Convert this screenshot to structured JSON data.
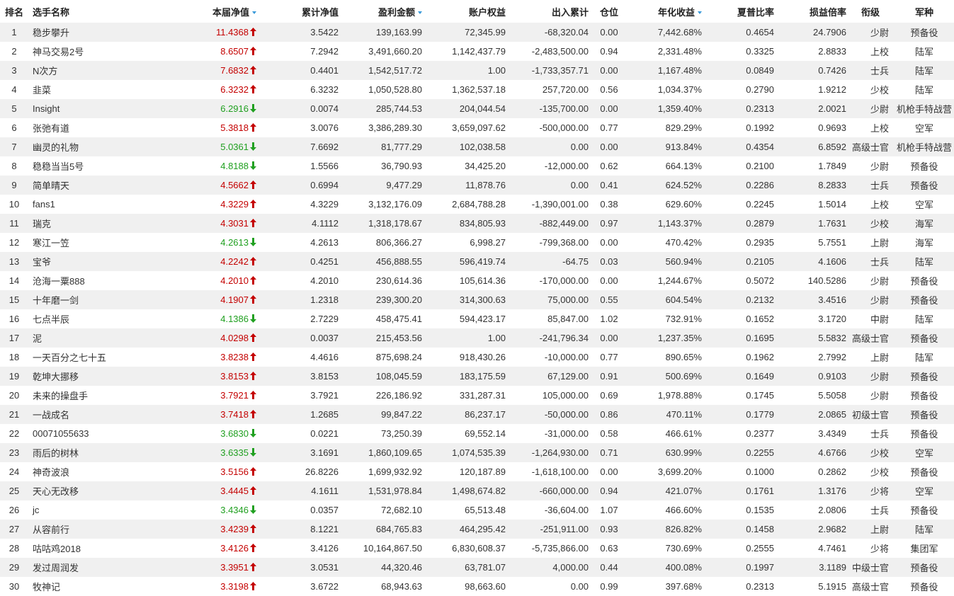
{
  "columns": {
    "rank": "排名",
    "name": "选手名称",
    "nav": "本届净值",
    "cum_nav": "累计净值",
    "profit": "盈利金额",
    "equity": "账户权益",
    "flow": "出入累计",
    "position": "仓位",
    "annual": "年化收益",
    "sharpe": "夏普比率",
    "pl_ratio": "损益倍率",
    "title": "衔级",
    "branch": "军种"
  },
  "sorted_columns": [
    "nav",
    "profit",
    "annual"
  ],
  "colors": {
    "up": "#c40000",
    "down": "#20a020",
    "stripe": "#f0f0f0",
    "sort_indicator": "#3a9ad9"
  },
  "rows": [
    {
      "rank": "1",
      "name": "稳步攀升",
      "nav": "11.4368",
      "trend": "up",
      "cum_nav": "3.5422",
      "profit": "139,163.99",
      "equity": "72,345.99",
      "flow": "-68,320.04",
      "position": "0.00",
      "annual": "7,442.68%",
      "sharpe": "0.4654",
      "pl_ratio": "24.7906",
      "title": "少尉",
      "branch": "预备役"
    },
    {
      "rank": "2",
      "name": "神马交易2号",
      "nav": "8.6507",
      "trend": "up",
      "cum_nav": "7.2942",
      "profit": "3,491,660.20",
      "equity": "1,142,437.79",
      "flow": "-2,483,500.00",
      "position": "0.94",
      "annual": "2,331.48%",
      "sharpe": "0.3325",
      "pl_ratio": "2.8833",
      "title": "上校",
      "branch": "陆军"
    },
    {
      "rank": "3",
      "name": "N次方",
      "nav": "7.6832",
      "trend": "up",
      "cum_nav": "0.4401",
      "profit": "1,542,517.72",
      "equity": "1.00",
      "flow": "-1,733,357.71",
      "position": "0.00",
      "annual": "1,167.48%",
      "sharpe": "0.0849",
      "pl_ratio": "0.7426",
      "title": "士兵",
      "branch": "陆军"
    },
    {
      "rank": "4",
      "name": "韭菜",
      "nav": "6.3232",
      "trend": "up",
      "cum_nav": "6.3232",
      "profit": "1,050,528.80",
      "equity": "1,362,537.18",
      "flow": "257,720.00",
      "position": "0.56",
      "annual": "1,034.37%",
      "sharpe": "0.2790",
      "pl_ratio": "1.9212",
      "title": "少校",
      "branch": "陆军"
    },
    {
      "rank": "5",
      "name": "Insight",
      "nav": "6.2916",
      "trend": "down",
      "cum_nav": "0.0074",
      "profit": "285,744.53",
      "equity": "204,044.54",
      "flow": "-135,700.00",
      "position": "0.00",
      "annual": "1,359.40%",
      "sharpe": "0.2313",
      "pl_ratio": "2.0021",
      "title": "少尉",
      "branch": "机枪手特战营"
    },
    {
      "rank": "6",
      "name": "张弛有道",
      "nav": "5.3818",
      "trend": "up",
      "cum_nav": "3.0076",
      "profit": "3,386,289.30",
      "equity": "3,659,097.62",
      "flow": "-500,000.00",
      "position": "0.77",
      "annual": "829.29%",
      "sharpe": "0.1992",
      "pl_ratio": "0.9693",
      "title": "上校",
      "branch": "空军"
    },
    {
      "rank": "7",
      "name": "幽灵的礼物",
      "nav": "5.0361",
      "trend": "down",
      "cum_nav": "7.6692",
      "profit": "81,777.29",
      "equity": "102,038.58",
      "flow": "0.00",
      "position": "0.00",
      "annual": "913.84%",
      "sharpe": "0.4354",
      "pl_ratio": "6.8592",
      "title": "高级士官",
      "branch": "机枪手特战营"
    },
    {
      "rank": "8",
      "name": "稳稳当当5号",
      "nav": "4.8188",
      "trend": "down",
      "cum_nav": "1.5566",
      "profit": "36,790.93",
      "equity": "34,425.20",
      "flow": "-12,000.00",
      "position": "0.62",
      "annual": "664.13%",
      "sharpe": "0.2100",
      "pl_ratio": "1.7849",
      "title": "少尉",
      "branch": "预备役"
    },
    {
      "rank": "9",
      "name": "简单晴天",
      "nav": "4.5662",
      "trend": "up",
      "cum_nav": "0.6994",
      "profit": "9,477.29",
      "equity": "11,878.76",
      "flow": "0.00",
      "position": "0.41",
      "annual": "624.52%",
      "sharpe": "0.2286",
      "pl_ratio": "8.2833",
      "title": "士兵",
      "branch": "预备役"
    },
    {
      "rank": "10",
      "name": "fans1",
      "nav": "4.3229",
      "trend": "up",
      "cum_nav": "4.3229",
      "profit": "3,132,176.09",
      "equity": "2,684,788.28",
      "flow": "-1,390,001.00",
      "position": "0.38",
      "annual": "629.60%",
      "sharpe": "0.2245",
      "pl_ratio": "1.5014",
      "title": "上校",
      "branch": "空军"
    },
    {
      "rank": "11",
      "name": "瑞克",
      "nav": "4.3031",
      "trend": "up",
      "cum_nav": "4.1112",
      "profit": "1,318,178.67",
      "equity": "834,805.93",
      "flow": "-882,449.00",
      "position": "0.97",
      "annual": "1,143.37%",
      "sharpe": "0.2879",
      "pl_ratio": "1.7631",
      "title": "少校",
      "branch": "海军"
    },
    {
      "rank": "12",
      "name": "寒江一笠",
      "nav": "4.2613",
      "trend": "down",
      "cum_nav": "4.2613",
      "profit": "806,366.27",
      "equity": "6,998.27",
      "flow": "-799,368.00",
      "position": "0.00",
      "annual": "470.42%",
      "sharpe": "0.2935",
      "pl_ratio": "5.7551",
      "title": "上尉",
      "branch": "海军"
    },
    {
      "rank": "13",
      "name": "宝爷",
      "nav": "4.2242",
      "trend": "up",
      "cum_nav": "0.4251",
      "profit": "456,888.55",
      "equity": "596,419.74",
      "flow": "-64.75",
      "position": "0.03",
      "annual": "560.94%",
      "sharpe": "0.2105",
      "pl_ratio": "4.1606",
      "title": "士兵",
      "branch": "陆军"
    },
    {
      "rank": "14",
      "name": "沧海一粟888",
      "nav": "4.2010",
      "trend": "up",
      "cum_nav": "4.2010",
      "profit": "230,614.36",
      "equity": "105,614.36",
      "flow": "-170,000.00",
      "position": "0.00",
      "annual": "1,244.67%",
      "sharpe": "0.5072",
      "pl_ratio": "140.5286",
      "title": "少尉",
      "branch": "预备役"
    },
    {
      "rank": "15",
      "name": "十年磨一剑",
      "nav": "4.1907",
      "trend": "up",
      "cum_nav": "1.2318",
      "profit": "239,300.20",
      "equity": "314,300.63",
      "flow": "75,000.00",
      "position": "0.55",
      "annual": "604.54%",
      "sharpe": "0.2132",
      "pl_ratio": "3.4516",
      "title": "少尉",
      "branch": "预备役"
    },
    {
      "rank": "16",
      "name": "七点半辰",
      "nav": "4.1386",
      "trend": "down",
      "cum_nav": "2.7229",
      "profit": "458,475.41",
      "equity": "594,423.17",
      "flow": "85,847.00",
      "position": "1.02",
      "annual": "732.91%",
      "sharpe": "0.1652",
      "pl_ratio": "3.1720",
      "title": "中尉",
      "branch": "陆军"
    },
    {
      "rank": "17",
      "name": "泥",
      "nav": "4.0298",
      "trend": "up",
      "cum_nav": "0.0037",
      "profit": "215,453.56",
      "equity": "1.00",
      "flow": "-241,796.34",
      "position": "0.00",
      "annual": "1,237.35%",
      "sharpe": "0.1695",
      "pl_ratio": "5.5832",
      "title": "高级士官",
      "branch": "预备役"
    },
    {
      "rank": "18",
      "name": "一天百分之七十五",
      "nav": "3.8238",
      "trend": "up",
      "cum_nav": "4.4616",
      "profit": "875,698.24",
      "equity": "918,430.26",
      "flow": "-10,000.00",
      "position": "0.77",
      "annual": "890.65%",
      "sharpe": "0.1962",
      "pl_ratio": "2.7992",
      "title": "上尉",
      "branch": "陆军"
    },
    {
      "rank": "19",
      "name": "乾坤大挪移",
      "nav": "3.8153",
      "trend": "up",
      "cum_nav": "3.8153",
      "profit": "108,045.59",
      "equity": "183,175.59",
      "flow": "67,129.00",
      "position": "0.91",
      "annual": "500.69%",
      "sharpe": "0.1649",
      "pl_ratio": "0.9103",
      "title": "少尉",
      "branch": "预备役"
    },
    {
      "rank": "20",
      "name": "未来的操盘手",
      "nav": "3.7921",
      "trend": "up",
      "cum_nav": "3.7921",
      "profit": "226,186.92",
      "equity": "331,287.31",
      "flow": "105,000.00",
      "position": "0.69",
      "annual": "1,978.88%",
      "sharpe": "0.1745",
      "pl_ratio": "5.5058",
      "title": "少尉",
      "branch": "预备役"
    },
    {
      "rank": "21",
      "name": "一战成名",
      "nav": "3.7418",
      "trend": "up",
      "cum_nav": "1.2685",
      "profit": "99,847.22",
      "equity": "86,237.17",
      "flow": "-50,000.00",
      "position": "0.86",
      "annual": "470.11%",
      "sharpe": "0.1779",
      "pl_ratio": "2.0865",
      "title": "初级士官",
      "branch": "预备役"
    },
    {
      "rank": "22",
      "name": "00071055633",
      "nav": "3.6830",
      "trend": "down",
      "cum_nav": "0.0221",
      "profit": "73,250.39",
      "equity": "69,552.14",
      "flow": "-31,000.00",
      "position": "0.58",
      "annual": "466.61%",
      "sharpe": "0.2377",
      "pl_ratio": "3.4349",
      "title": "士兵",
      "branch": "预备役"
    },
    {
      "rank": "23",
      "name": "雨后的树林",
      "nav": "3.6335",
      "trend": "down",
      "cum_nav": "3.1691",
      "profit": "1,860,109.65",
      "equity": "1,074,535.39",
      "flow": "-1,264,930.00",
      "position": "0.71",
      "annual": "630.99%",
      "sharpe": "0.2255",
      "pl_ratio": "4.6766",
      "title": "少校",
      "branch": "空军"
    },
    {
      "rank": "24",
      "name": "神奇波浪",
      "nav": "3.5156",
      "trend": "up",
      "cum_nav": "26.8226",
      "profit": "1,699,932.92",
      "equity": "120,187.89",
      "flow": "-1,618,100.00",
      "position": "0.00",
      "annual": "3,699.20%",
      "sharpe": "0.1000",
      "pl_ratio": "0.2862",
      "title": "少校",
      "branch": "预备役"
    },
    {
      "rank": "25",
      "name": "天心无改移",
      "nav": "3.4445",
      "trend": "up",
      "cum_nav": "4.1611",
      "profit": "1,531,978.84",
      "equity": "1,498,674.82",
      "flow": "-660,000.00",
      "position": "0.94",
      "annual": "421.07%",
      "sharpe": "0.1761",
      "pl_ratio": "1.3176",
      "title": "少将",
      "branch": "空军"
    },
    {
      "rank": "26",
      "name": "jc",
      "nav": "3.4346",
      "trend": "down",
      "cum_nav": "0.0357",
      "profit": "72,682.10",
      "equity": "65,513.48",
      "flow": "-36,604.00",
      "position": "1.07",
      "annual": "466.60%",
      "sharpe": "0.1535",
      "pl_ratio": "2.0806",
      "title": "士兵",
      "branch": "预备役"
    },
    {
      "rank": "27",
      "name": "从容前行",
      "nav": "3.4239",
      "trend": "up",
      "cum_nav": "8.1221",
      "profit": "684,765.83",
      "equity": "464,295.42",
      "flow": "-251,911.00",
      "position": "0.93",
      "annual": "826.82%",
      "sharpe": "0.1458",
      "pl_ratio": "2.9682",
      "title": "上尉",
      "branch": "陆军"
    },
    {
      "rank": "28",
      "name": "咕咕鸡2018",
      "nav": "3.4126",
      "trend": "up",
      "cum_nav": "3.4126",
      "profit": "10,164,867.50",
      "equity": "6,830,608.37",
      "flow": "-5,735,866.00",
      "position": "0.63",
      "annual": "730.69%",
      "sharpe": "0.2555",
      "pl_ratio": "4.7461",
      "title": "少将",
      "branch": "集团军"
    },
    {
      "rank": "29",
      "name": "发过周润发",
      "nav": "3.3951",
      "trend": "up",
      "cum_nav": "3.0531",
      "profit": "44,320.46",
      "equity": "63,781.07",
      "flow": "4,000.00",
      "position": "0.44",
      "annual": "400.08%",
      "sharpe": "0.1997",
      "pl_ratio": "3.1189",
      "title": "中级士官",
      "branch": "预备役"
    },
    {
      "rank": "30",
      "name": "牧神记",
      "nav": "3.3198",
      "trend": "up",
      "cum_nav": "3.6722",
      "profit": "68,943.63",
      "equity": "98,663.60",
      "flow": "0.00",
      "position": "0.99",
      "annual": "397.68%",
      "sharpe": "0.2313",
      "pl_ratio": "5.1915",
      "title": "高级士官",
      "branch": "预备役"
    }
  ]
}
